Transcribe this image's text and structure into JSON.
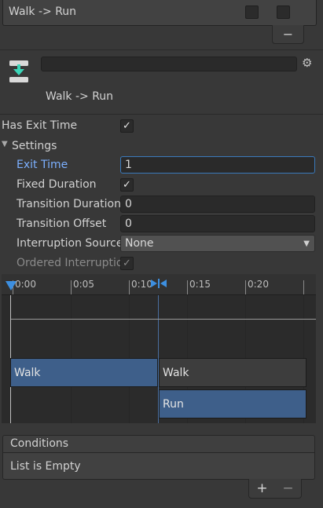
{
  "transitions_list": {
    "item_label": "Walk -> Run",
    "remove_label": "−"
  },
  "header": {
    "title": "Walk -> Run",
    "name_value": "",
    "icon": "transition-icon",
    "settings_icon": "gear-icon"
  },
  "has_exit_time": {
    "label": "Has Exit Time",
    "checked": true
  },
  "settings": {
    "label": "Settings",
    "expanded": true,
    "exit_time": {
      "label": "Exit Time",
      "value": "1"
    },
    "fixed_duration": {
      "label": "Fixed Duration",
      "checked": true
    },
    "transition_duration": {
      "label": "Transition Duration",
      "value": "0"
    },
    "transition_offset": {
      "label": "Transition Offset",
      "value": "0"
    },
    "interruption_source": {
      "label": "Interruption Source",
      "value": "None"
    },
    "ordered_interruption": {
      "label": "Ordered Interruption",
      "checked": true
    }
  },
  "timeline": {
    "ticks": [
      "0:00",
      "0:05",
      "0:10",
      "0:15",
      "0:20"
    ],
    "tracks": [
      {
        "name": "Walk"
      },
      {
        "name": "Walk"
      },
      {
        "name": "Run"
      }
    ]
  },
  "conditions": {
    "title": "Conditions",
    "empty_text": "List is Empty",
    "add_label": "+",
    "remove_label": "−"
  },
  "colors": {
    "accent": "#7cb0ff",
    "state_blue": "#3e5f8a",
    "background": "#383838"
  }
}
